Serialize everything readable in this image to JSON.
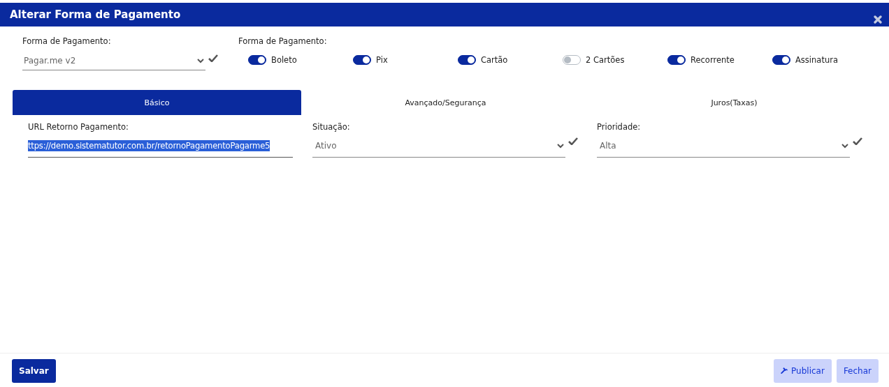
{
  "window": {
    "title": "Alterar Forma de Pagamento"
  },
  "payment_select": {
    "label": "Forma de Pagamento:",
    "value": "Pagar.me v2"
  },
  "payment_methods": {
    "label": "Forma de Pagamento:",
    "toggles": [
      {
        "label": "Boleto",
        "on": true
      },
      {
        "label": "Pix",
        "on": true
      },
      {
        "label": "Cartão",
        "on": true
      },
      {
        "label": "2 Cartões",
        "on": false
      },
      {
        "label": "Recorrente",
        "on": true
      },
      {
        "label": "Assinatura",
        "on": true
      }
    ]
  },
  "tabs": [
    {
      "label": "Básico",
      "selected": true
    },
    {
      "label": "Avançado/Segurança",
      "selected": false
    },
    {
      "label": "Juros(Taxas)",
      "selected": false
    }
  ],
  "fields": [
    {
      "kind": "text",
      "label": "URL Retorno Pagamento:",
      "value": "ttps://demo.sistematutor.com.br/retornoPagamentoPagarme5",
      "text_selected": true
    },
    {
      "kind": "select",
      "label": "Situação:",
      "value": "Ativo"
    },
    {
      "kind": "select",
      "label": "Prioridade:",
      "value": "Alta"
    }
  ],
  "footer": {
    "save": "Salvar",
    "publish": "Publicar",
    "close": "Fechar"
  }
}
